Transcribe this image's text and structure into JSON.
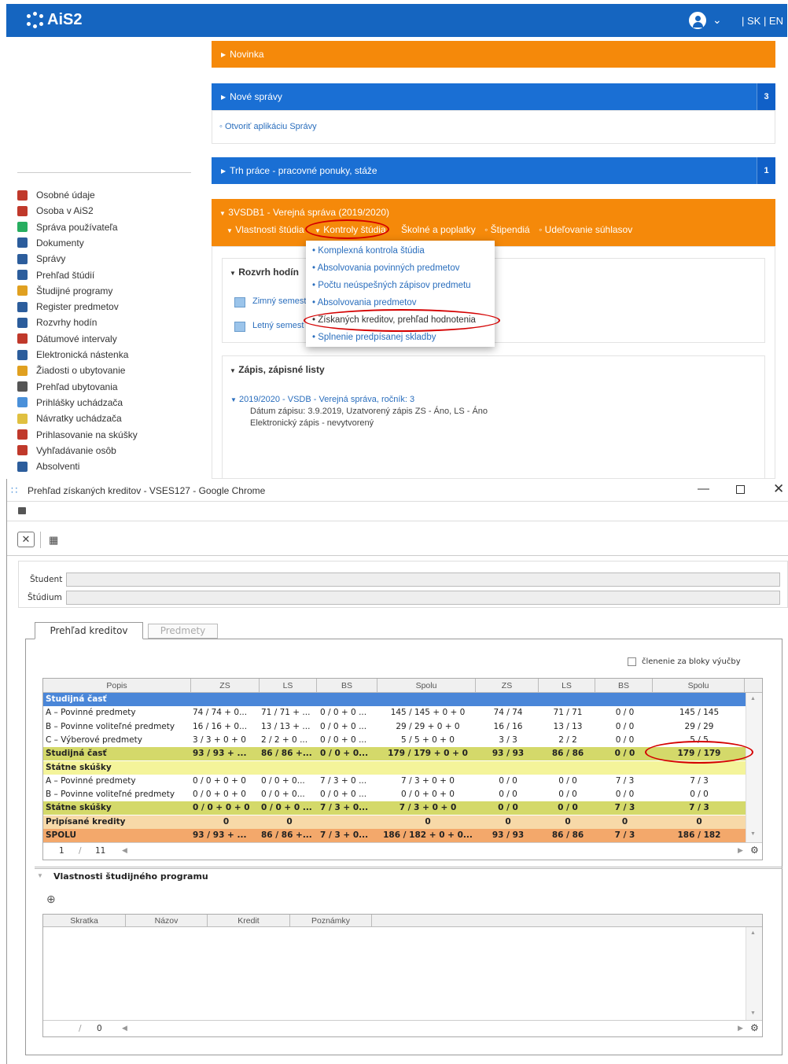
{
  "app": {
    "logo": "AiS2",
    "lang": "| SK | EN"
  },
  "panels": {
    "novinka": "Novinka",
    "nove_spravy": "Nové správy",
    "nove_spravy_badge": "3",
    "otvorit": "Otvoriť aplikáciu Správy",
    "trh": "Trh práce - pracovné ponuky, stáže",
    "trh_badge": "1",
    "study": "3VSDB1 - Verejná správa (2019/2020)"
  },
  "subnav": [
    "Vlastnosti štúdia",
    "Kontroly štúdia",
    "Školné a poplatky",
    "Štipendiá",
    "Udeľovanie súhlasov"
  ],
  "dropdown": [
    "Komplexná kontrola štúdia",
    "Absolvovania povinných predmetov",
    "Počtu neúspešných zápisov predmetu",
    "Absolvovania predmetov",
    "Získaných kreditov, prehľad hodnotenia",
    "Splnenie predpísanej skladby"
  ],
  "rozvrh": {
    "title": "Rozvrh hodín",
    "zimny": "Zimný semest",
    "letny": "Letný semest"
  },
  "zapis": {
    "title": "Zápis, zápisné listy",
    "item": "2019/2020 - VSDB - Verejná správa, ročník: 3",
    "line1": "Dátum zápisu: 3.9.2019, Uzatvorený zápis ZS - Áno, LS - Áno",
    "line2": "Elektronický zápis - nevytvorený"
  },
  "sidebar": [
    "Osobné údaje",
    "Osoba v AiS2",
    "Správa používateľa",
    "Dokumenty",
    "Správy",
    "Prehľad štúdií",
    "Študijné programy",
    "Register predmetov",
    "Rozvrhy hodín",
    "Dátumové intervaly",
    "Elektronická nástenka",
    "Žiadosti o ubytovanie",
    "Prehľad ubytovania",
    "Prihlášky uchádzača",
    "Návratky uchádzača",
    "Prihlasovanie na skúšky",
    "Vyhľadávanie osôb",
    "Absolventi"
  ],
  "sidebar_colors": [
    "#c0392b",
    "#c0392b",
    "#27ae60",
    "#2c5d9c",
    "#2c5d9c",
    "#2c5d9c",
    "#e0a020",
    "#2c5d9c",
    "#2c5d9c",
    "#c0392b",
    "#2c5d9c",
    "#e0a020",
    "#555555",
    "#4a90d9",
    "#e0c040",
    "#c0392b",
    "#c0392b",
    "#2c5d9c"
  ],
  "window": {
    "title": "Prehľad získaných kreditov - VSES127 - Google Chrome",
    "student_label": "Študent",
    "studium_label": "Štúdium",
    "tab1": "Prehľad kreditov",
    "tab2": "Predmety",
    "checkbox": "členenie za bloky výučby",
    "pager": {
      "page": "1",
      "total": "11"
    },
    "props_title": "Vlastnosti študijného programu",
    "props_cols": [
      "Skratka",
      "Názov",
      "Kredit",
      "Poznámky"
    ],
    "pager2": {
      "page": "",
      "total": "0"
    }
  },
  "table": {
    "columns": [
      "Popis",
      "ZS",
      "LS",
      "BS",
      "Spolu",
      "ZS",
      "LS",
      "BS",
      "Spolu"
    ],
    "rows": [
      {
        "type": "group",
        "cells": [
          "Študijná časť"
        ]
      },
      {
        "type": "data",
        "cells": [
          "A – Povinné predmety",
          "74 / 74 + 0...",
          "71 / 71 + ...",
          "0 / 0 + 0 ...",
          "145 / 145 + 0 + 0",
          "74 / 74",
          "71 / 71",
          "0 / 0",
          "145 / 145"
        ]
      },
      {
        "type": "data",
        "cells": [
          "B – Povinne voliteľné predmety",
          "16 / 16 + 0...",
          "13 / 13 + ...",
          "0 / 0 + 0 ...",
          "29 / 29 + 0 + 0",
          "16 / 16",
          "13 / 13",
          "0 / 0",
          "29 / 29"
        ]
      },
      {
        "type": "data",
        "cells": [
          "C – Výberové predmety",
          "3 / 3 + 0 + 0",
          "2 / 2 + 0 ...",
          "0 / 0 + 0 ...",
          "5 / 5 + 0 + 0",
          "3 / 3",
          "2 / 2",
          "0 / 0",
          "5 / 5"
        ]
      },
      {
        "type": "sum",
        "cells": [
          "Študijná časť",
          "93 / 93 + ...",
          "86 / 86 +...",
          "0 / 0 + 0...",
          "179 / 179 + 0 + 0",
          "93 / 93",
          "86 / 86",
          "0 / 0",
          "179 / 179"
        ]
      },
      {
        "type": "group2",
        "cells": [
          "Štátne skúšky"
        ]
      },
      {
        "type": "data",
        "cells": [
          "A – Povinné predmety",
          "0 / 0 + 0 + 0",
          "0 / 0 + 0...",
          "7 / 3 + 0 ...",
          "7 / 3 + 0 + 0",
          "0 / 0",
          "0 / 0",
          "7 / 3",
          "7 / 3"
        ]
      },
      {
        "type": "data",
        "cells": [
          "B – Povinne voliteľné predmety",
          "0 / 0 + 0 + 0",
          "0 / 0 + 0...",
          "0 / 0 + 0 ...",
          "0 / 0 + 0 + 0",
          "0 / 0",
          "0 / 0",
          "0 / 0",
          "0 / 0"
        ]
      },
      {
        "type": "sum",
        "cells": [
          "Štátne skúšky",
          "0 / 0 + 0 + 0",
          "0 / 0 + 0 ...",
          "7 / 3 + 0...",
          "7 / 3 + 0 + 0",
          "0 / 0",
          "0 / 0",
          "7 / 3",
          "7 / 3"
        ]
      },
      {
        "type": "ext",
        "cells": [
          "Pripísané kredity",
          "0",
          "0",
          "",
          "0",
          "0",
          "0",
          "0",
          "0"
        ]
      },
      {
        "type": "total",
        "cells": [
          "SPOLU",
          "93 / 93 + ...",
          "86 / 86 +...",
          "7 / 3 + 0...",
          "186 / 182 + 0 + 0...",
          "93 / 93",
          "86 / 86",
          "7 / 3",
          "186 / 182"
        ]
      }
    ]
  },
  "colors": {
    "brand": "#1565c0",
    "orange": "#f5890a",
    "blue": "#1a6fd4",
    "group": "#4a86d8",
    "sum": "#d4d96a",
    "group2": "#f4f49a",
    "ext": "#f7d9a8",
    "total": "#f3a86b",
    "highlight": "#d40000"
  }
}
